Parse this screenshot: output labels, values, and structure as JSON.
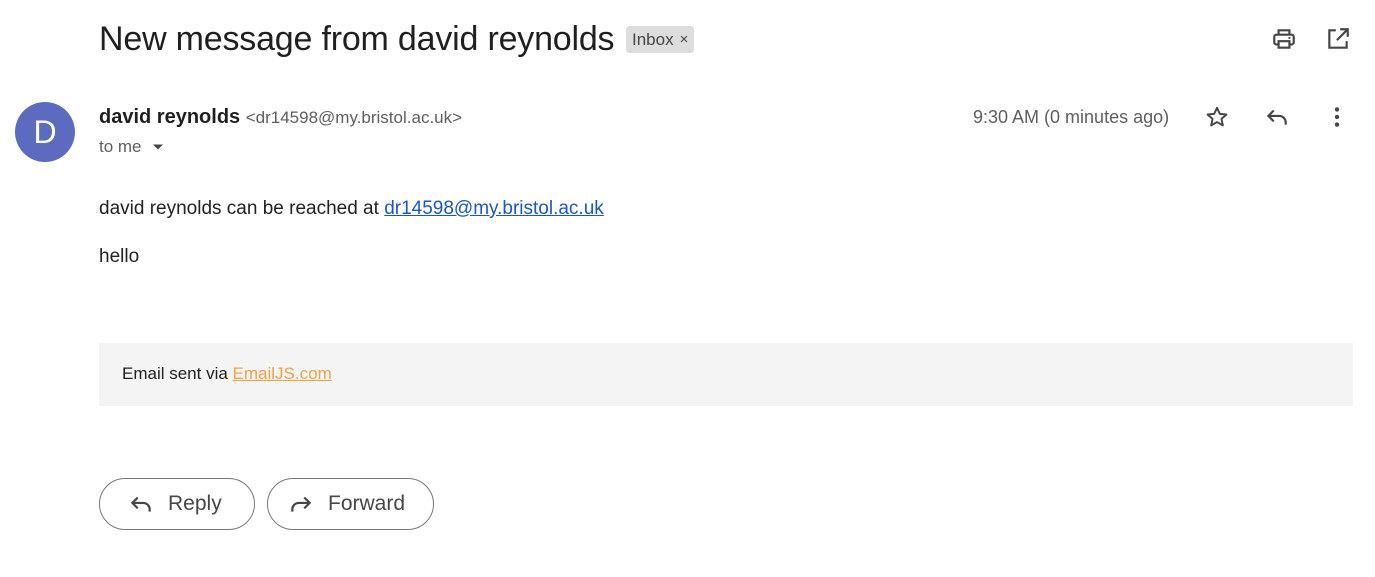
{
  "email": {
    "subject": "New message from david reynolds",
    "label": "Inbox",
    "label_remove_glyph": "×",
    "sender": {
      "avatar_letter": "D",
      "name": "david reynolds",
      "email_display": "<dr14598@my.bristol.ac.uk>"
    },
    "recipient": "to me",
    "timestamp": "9:30 AM (0 minutes ago)",
    "body": {
      "line1_prefix": "david reynolds can be reached at ",
      "line1_link": "dr14598@my.bristol.ac.uk",
      "line2": "hello"
    },
    "footer": {
      "prefix": "Email sent via ",
      "link": "EmailJS.com"
    }
  },
  "actions": {
    "reply_label": "Reply",
    "forward_label": "Forward"
  },
  "icons": {
    "print": "print-icon",
    "open_new_window": "open-in-new-icon",
    "star": "star-icon",
    "reply": "reply-icon",
    "more": "more-vert-icon",
    "dropdown": "caret-down-icon",
    "forward": "forward-icon"
  },
  "colors": {
    "avatar_bg": "#5c6bc0",
    "link_blue": "#1a56c4",
    "link_orange": "#f4a044",
    "chip_bg": "#dddddd",
    "footer_bg": "#f4f4f4"
  }
}
